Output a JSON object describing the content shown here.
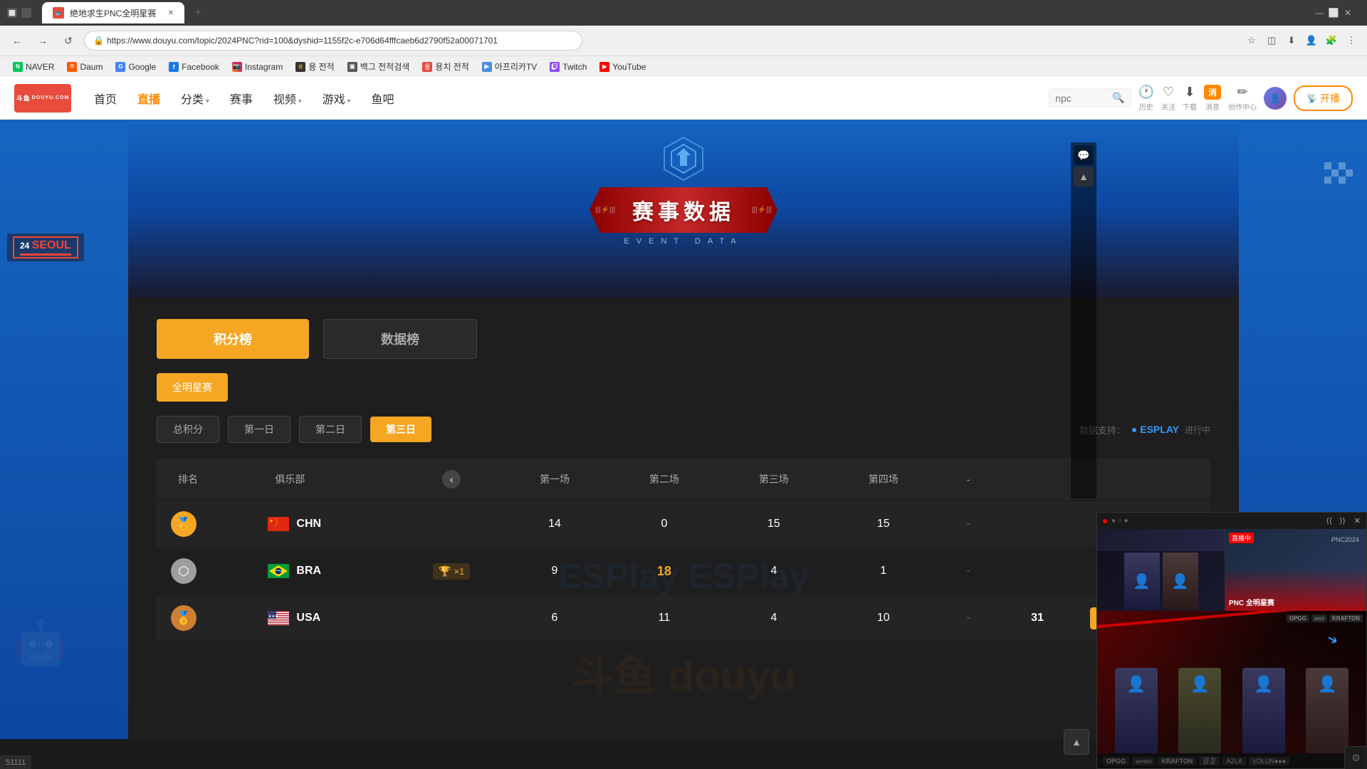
{
  "browser": {
    "tab_title": "绝地求生PNC全明星赛",
    "url": "https://www.douyu.com/topic/2024PNC?rid=100&dyshid=1155f2c-e706d64fffcaeb6d2790f52a00071701",
    "back_btn": "←",
    "forward_btn": "→",
    "refresh_btn": "↺",
    "bookmarks": [
      {
        "label": "NAVER",
        "type": "naver"
      },
      {
        "label": "Daum",
        "type": "daum"
      },
      {
        "label": "Google",
        "type": "google"
      },
      {
        "label": "Facebook",
        "type": "facebook"
      },
      {
        "label": "Instagram",
        "type": "instagram"
      },
      {
        "label": "용 전적",
        "type": "yong"
      },
      {
        "label": "백그 전적검색",
        "type": "baekg"
      },
      {
        "label": "용치 전적",
        "type": "yongji"
      },
      {
        "label": "아프리카TV",
        "type": "afreeca"
      },
      {
        "label": "Twitch",
        "type": "twitch"
      },
      {
        "label": "YouTube",
        "type": "youtube"
      }
    ]
  },
  "site": {
    "logo_text": "斗鱼",
    "search_placeholder": "npc",
    "nav_items": [
      {
        "label": "首页",
        "arrow": false,
        "active": false
      },
      {
        "label": "直播",
        "arrow": false,
        "active": true
      },
      {
        "label": "分类",
        "arrow": true,
        "active": false
      },
      {
        "label": "赛事",
        "arrow": false,
        "active": false
      },
      {
        "label": "视频",
        "arrow": true,
        "active": false
      },
      {
        "label": "游戏",
        "arrow": true,
        "active": false
      },
      {
        "label": "鱼吧",
        "arrow": false,
        "active": false
      }
    ],
    "header_btns": [
      "历史",
      "关注",
      "下载",
      "消息",
      "创作中心"
    ],
    "live_btn": "开播"
  },
  "event": {
    "title_cn": "赛事数据",
    "title_en": "EVENT  DATA",
    "main_tabs": [
      {
        "label": "积分榜",
        "active": true
      },
      {
        "label": "数据榜",
        "active": false
      }
    ],
    "filter_label": "全明星赛",
    "day_tabs": [
      {
        "label": "总积分",
        "active": false
      },
      {
        "label": "第一日",
        "active": false
      },
      {
        "label": "第二日",
        "active": false
      },
      {
        "label": "第三日",
        "active": true
      }
    ],
    "data_support_label": "数据支持：",
    "esplay_label": "○ ESPLAY",
    "table": {
      "headers": {
        "rank": "排名",
        "club": "俱乐部",
        "match1": "第一场",
        "match2": "第二场",
        "match3": "第三场",
        "match4": "第四场"
      },
      "rows": [
        {
          "rank": 1,
          "rank_type": "gold",
          "country": "CHN",
          "country_flag": "cn",
          "badge": "",
          "m1": "14",
          "m2": "0",
          "m3": "15",
          "m4": "15",
          "total": "",
          "has_details": false
        },
        {
          "rank": 2,
          "rank_type": "silver",
          "country": "BRA",
          "country_flag": "br",
          "badge": "×1",
          "m1": "9",
          "m2": "18",
          "m3": "4",
          "m4": "1",
          "total": "",
          "has_details": false
        },
        {
          "rank": 3,
          "rank_type": "bronze",
          "country": "USA",
          "country_flag": "us",
          "badge": "",
          "m1": "6",
          "m2": "11",
          "m3": "4",
          "m4": "10",
          "total": "31",
          "has_details": true
        }
      ]
    }
  },
  "floating_player": {
    "dot_color": "#f00",
    "sponsor_labels": [
      "OPGG",
      "a∞ws",
      "KRAFTON",
      "∭∭∭",
      "○○○○○",
      "AZLA",
      "○○○○○○○"
    ]
  },
  "viewer_count": "51111",
  "seoul_text": "24 SEOUL"
}
